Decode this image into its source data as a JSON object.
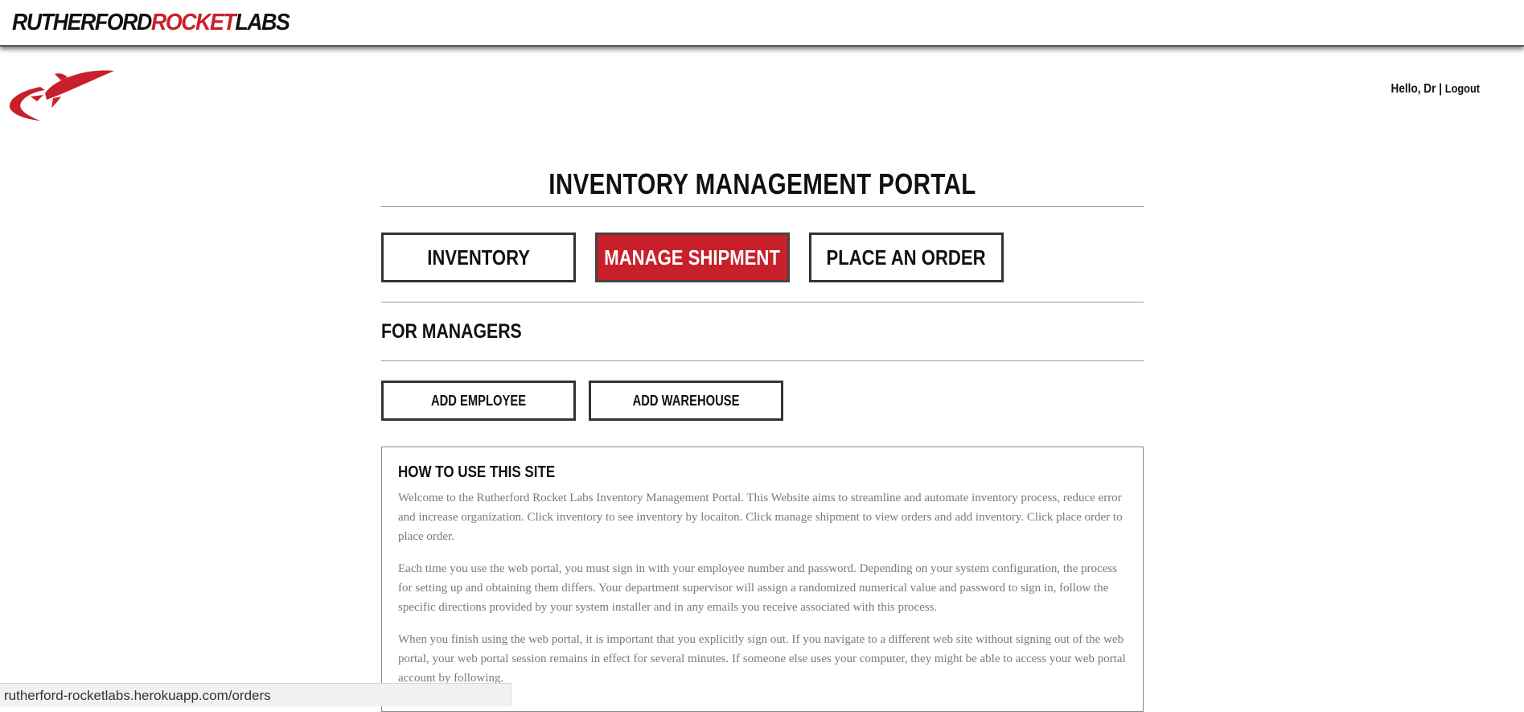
{
  "header": {
    "brand_part1": "RUTHERFORD",
    "brand_part2": "ROCKET",
    "brand_part3": "LABS"
  },
  "logo": {
    "icon": "rocket-icon"
  },
  "user": {
    "greeting": "Hello, Dr |",
    "logout_label": "Logout"
  },
  "main": {
    "title": "INVENTORY MANAGEMENT PORTAL",
    "nav_buttons": [
      {
        "label": "INVENTORY",
        "active": false
      },
      {
        "label": "MANAGE SHIPMENT",
        "active": true
      },
      {
        "label": "PLACE AN ORDER",
        "active": false
      }
    ],
    "managers_heading": "FOR MANAGERS",
    "manager_buttons": [
      {
        "label": "ADD EMPLOYEE"
      },
      {
        "label": "ADD WAREHOUSE"
      }
    ]
  },
  "help": {
    "title": "HOW TO USE THIS SITE",
    "paragraphs": [
      "Welcome to the Rutherford Rocket Labs Inventory Management Portal. This Website aims to streamline and automate inventory process, reduce error and increase organization. Click inventory to see inventory by locaiton. Click manage shipment to view orders and add inventory. Click place order to place order.",
      "Each time you use the web portal, you must sign in with your employee number and password. Depending on your system configuration, the process for setting up and obtaining them differs. Your department supervisor will assign a randomized numerical value and password to sign in, follow the specific directions provided by your system installer and in any emails you receive associated with this process.",
      "When you finish using the web portal, it is important that you explicitly sign out. If you navigate to a different web site without signing out of the web portal, your web portal session remains in effect for several minutes. If someone else uses your computer, they might be able to access your web portal account by following."
    ]
  },
  "status_bar": {
    "url": "rutherford-rocketlabs.herokuapp.com/orders"
  },
  "colors": {
    "brand_red": "#c8202a",
    "text_dark": "#111111",
    "body_gray": "#7a7a7a"
  }
}
